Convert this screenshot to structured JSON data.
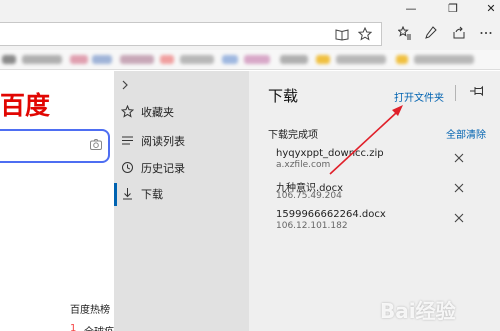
{
  "window": {
    "minimize_glyph": "—",
    "maximize_glyph": "❐",
    "close_glyph": "✕"
  },
  "toolbar": {
    "reading_view_icon": "book-icon",
    "favorite_icon": "star-icon",
    "favorites_hub_icon": "star-list-icon",
    "notes_icon": "pen-icon",
    "share_icon": "share-icon",
    "more_icon": "more-icon"
  },
  "page": {
    "logo_text": "百度",
    "hot_title": "百度热榜",
    "hot_item_num": "1",
    "hot_item_text": "全球疫"
  },
  "hub_nav": {
    "items": [
      {
        "label": "收藏夹",
        "icon": "favorites-icon"
      },
      {
        "label": "阅读列表",
        "icon": "reading-list-icon"
      },
      {
        "label": "历史记录",
        "icon": "history-icon"
      },
      {
        "label": "下载",
        "icon": "download-icon"
      }
    ]
  },
  "downloads": {
    "title": "下载",
    "open_folder": "打开文件夹",
    "section_label": "下载完成项",
    "clear_all": "全部清除",
    "items": [
      {
        "name": "hyqyxppt_downcc.zip",
        "source": "a.xzfile.com"
      },
      {
        "name": "九种意识.docx",
        "source": "106.75.49.204"
      },
      {
        "name": "1599966662264.docx",
        "source": "106.12.101.182"
      }
    ]
  },
  "colors": {
    "accent": "#0063b1",
    "logo_red": "#e10602",
    "arrow_red": "#e0202a"
  },
  "watermark": {
    "text": "Bai经验"
  }
}
